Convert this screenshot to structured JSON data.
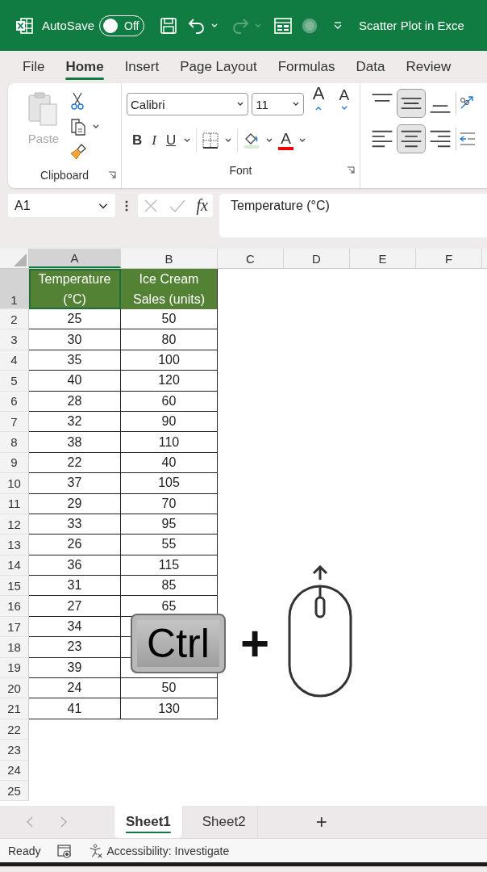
{
  "title_bar": {
    "autosave_label": "AutoSave",
    "autosave": {
      "on": false,
      "label": "Off"
    },
    "title": "Scatter Plot in Exce"
  },
  "menu_tabs": [
    {
      "label": "File",
      "selected": false
    },
    {
      "label": "Home",
      "selected": true
    },
    {
      "label": "Insert",
      "selected": false
    },
    {
      "label": "Page Layout",
      "selected": false
    },
    {
      "label": "Formulas",
      "selected": false
    },
    {
      "label": "Data",
      "selected": false
    },
    {
      "label": "Review",
      "selected": false
    }
  ],
  "ribbon": {
    "clipboard": {
      "paste_label": "Paste",
      "group_label": "Clipboard"
    },
    "font": {
      "font_name": "Calibri",
      "font_size": "11",
      "grow": "A",
      "shrink": "A",
      "bold": "B",
      "italic": "I",
      "underline": "U",
      "font_color": "A",
      "group_label": "Font"
    },
    "alignment": [
      {
        "kind": "top",
        "selected": false
      },
      {
        "kind": "middle",
        "selected": true
      },
      {
        "kind": "bottom",
        "selected": false
      },
      {
        "kind": "left",
        "selected": false
      },
      {
        "kind": "center",
        "selected": true
      },
      {
        "kind": "right",
        "selected": false
      }
    ]
  },
  "formula_bar": {
    "name_box": "A1",
    "fx": "fx",
    "content": "Temperature (°C)"
  },
  "sheet": {
    "columns": [
      {
        "label": "A",
        "selected": true
      },
      {
        "label": "B",
        "selected": false
      },
      {
        "label": "C",
        "selected": false
      },
      {
        "label": "D",
        "selected": false
      },
      {
        "label": "E",
        "selected": false
      },
      {
        "label": "F",
        "selected": false
      }
    ],
    "rows": [
      {
        "number": "1",
        "kind": "header",
        "selected": true,
        "cells": [
          "Temperature (°C)",
          "Ice Cream Sales (units)"
        ]
      },
      {
        "number": "2",
        "kind": "data",
        "selected": false,
        "cells": [
          "25",
          "50"
        ]
      },
      {
        "number": "3",
        "kind": "data",
        "selected": false,
        "cells": [
          "30",
          "80"
        ]
      },
      {
        "number": "4",
        "kind": "data",
        "selected": false,
        "cells": [
          "35",
          "100"
        ]
      },
      {
        "number": "5",
        "kind": "data",
        "selected": false,
        "cells": [
          "40",
          "120"
        ]
      },
      {
        "number": "6",
        "kind": "data",
        "selected": false,
        "cells": [
          "28",
          "60"
        ]
      },
      {
        "number": "7",
        "kind": "data",
        "selected": false,
        "cells": [
          "32",
          "90"
        ]
      },
      {
        "number": "8",
        "kind": "data",
        "selected": false,
        "cells": [
          "38",
          "110"
        ]
      },
      {
        "number": "9",
        "kind": "data",
        "selected": false,
        "cells": [
          "22",
          "40"
        ]
      },
      {
        "number": "10",
        "kind": "data",
        "selected": false,
        "cells": [
          "37",
          "105"
        ]
      },
      {
        "number": "11",
        "kind": "data",
        "selected": false,
        "cells": [
          "29",
          "70"
        ]
      },
      {
        "number": "12",
        "kind": "data",
        "selected": false,
        "cells": [
          "33",
          "95"
        ]
      },
      {
        "number": "13",
        "kind": "data",
        "selected": false,
        "cells": [
          "26",
          "55"
        ]
      },
      {
        "number": "14",
        "kind": "data",
        "selected": false,
        "cells": [
          "36",
          "115"
        ]
      },
      {
        "number": "15",
        "kind": "data",
        "selected": false,
        "cells": [
          "31",
          "85"
        ]
      },
      {
        "number": "16",
        "kind": "data",
        "selected": false,
        "cells": [
          "27",
          "65"
        ]
      },
      {
        "number": "17",
        "kind": "data",
        "selected": false,
        "cells": [
          "34"
        ]
      },
      {
        "number": "18",
        "kind": "data",
        "selected": false,
        "cells": [
          "23"
        ]
      },
      {
        "number": "19",
        "kind": "data",
        "selected": false,
        "cells": [
          "39"
        ]
      },
      {
        "number": "20",
        "kind": "data",
        "selected": false,
        "cells": [
          "24",
          "50"
        ]
      },
      {
        "number": "21",
        "kind": "data",
        "selected": false,
        "cells": [
          "41",
          "130"
        ]
      },
      {
        "number": "22",
        "kind": "empty",
        "selected": false,
        "cells": []
      },
      {
        "number": "23",
        "kind": "empty",
        "selected": false,
        "cells": []
      },
      {
        "number": "24",
        "kind": "empty",
        "selected": false,
        "cells": []
      },
      {
        "number": "25",
        "kind": "empty",
        "selected": false,
        "cells": []
      }
    ]
  },
  "overlay": {
    "key_label": "Ctrl",
    "plus": "+"
  },
  "sheet_tabs": [
    {
      "label": "Sheet1",
      "selected": true
    },
    {
      "label": "Sheet2",
      "selected": false
    }
  ],
  "new_sheet": "+",
  "status_bar": {
    "ready": "Ready",
    "accessibility": "Accessibility: Investigate"
  }
}
